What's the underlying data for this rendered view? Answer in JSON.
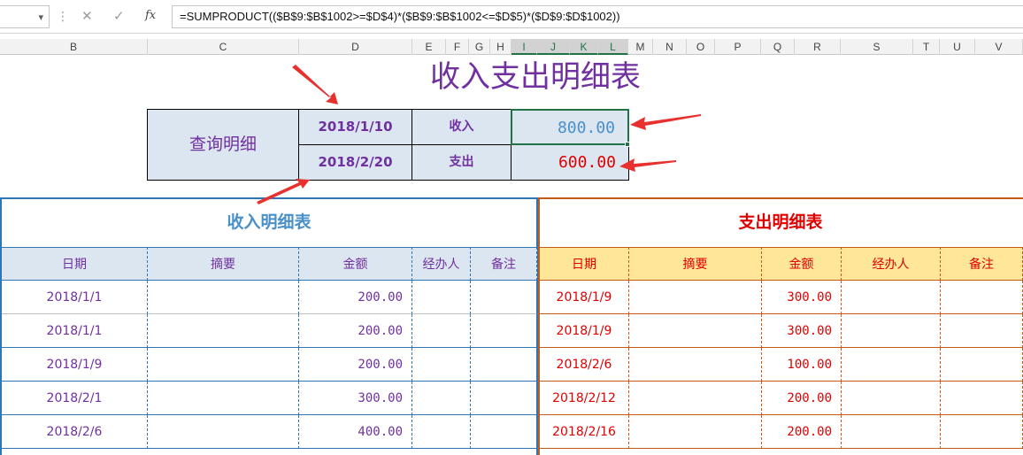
{
  "formula_bar": {
    "name_box_value": "",
    "fx_label": "fx",
    "cancel_glyph": "✕",
    "enter_glyph": "✓",
    "formula": "=SUMPRODUCT(($B$9:$B$1002>=$D$4)*($B$9:$B$1002<=$D$5)*($D$9:$D$1002))"
  },
  "columns": [
    "B",
    "C",
    "D",
    "E",
    "F",
    "G",
    "H",
    "I",
    "J",
    "K",
    "L",
    "M",
    "N",
    "O",
    "P",
    "Q",
    "R",
    "S",
    "T",
    "U",
    "V"
  ],
  "sheet": {
    "title": "收入支出明细表",
    "query": {
      "label": "查询明细",
      "date_from": "2018/1/10",
      "date_to": "2018/2/20",
      "income_label": "收入",
      "expense_label": "支出",
      "income_value": "800.00",
      "expense_value": "600.00"
    },
    "income": {
      "title": "收入明细表",
      "headers": [
        "日期",
        "摘要",
        "金额",
        "经办人",
        "备注"
      ],
      "rows": [
        {
          "date": "2018/1/1",
          "summary": "",
          "amount": "200.00",
          "handler": "",
          "note": ""
        },
        {
          "date": "2018/1/1",
          "summary": "",
          "amount": "200.00",
          "handler": "",
          "note": ""
        },
        {
          "date": "2018/1/9",
          "summary": "",
          "amount": "200.00",
          "handler": "",
          "note": ""
        },
        {
          "date": "2018/2/1",
          "summary": "",
          "amount": "300.00",
          "handler": "",
          "note": ""
        },
        {
          "date": "2018/2/6",
          "summary": "",
          "amount": "400.00",
          "handler": "",
          "note": ""
        }
      ]
    },
    "expense": {
      "title": "支出明细表",
      "headers": [
        "日期",
        "摘要",
        "金额",
        "经办人",
        "备注"
      ],
      "rows": [
        {
          "date": "2018/1/9",
          "summary": "",
          "amount": "300.00",
          "handler": "",
          "note": ""
        },
        {
          "date": "2018/1/9",
          "summary": "",
          "amount": "300.00",
          "handler": "",
          "note": ""
        },
        {
          "date": "2018/2/6",
          "summary": "",
          "amount": "100.00",
          "handler": "",
          "note": ""
        },
        {
          "date": "2018/2/12",
          "summary": "",
          "amount": "200.00",
          "handler": "",
          "note": ""
        },
        {
          "date": "2018/2/16",
          "summary": "",
          "amount": "200.00",
          "handler": "",
          "note": ""
        }
      ]
    }
  },
  "colors": {
    "title": "#7030a0",
    "income_accent": "#2e75b6",
    "expense_accent": "#c55a11",
    "selection": "#217346",
    "annotation_arrow": "#e8312f"
  }
}
